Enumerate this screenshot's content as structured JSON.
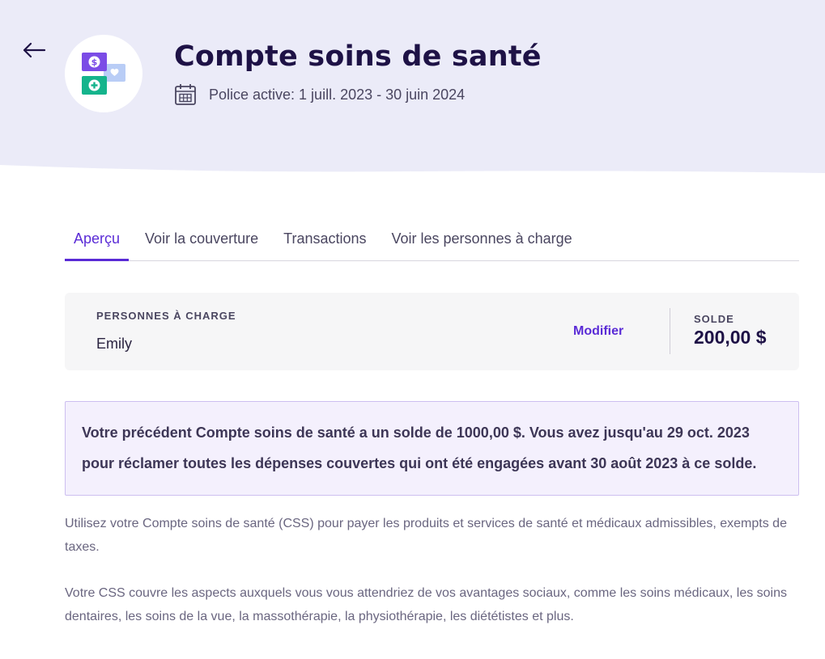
{
  "header": {
    "title": "Compte soins de santé",
    "policy_period": "Police active: 1 juill. 2023 - 30 juin 2024",
    "background_color": "#ebebf8"
  },
  "tabs": [
    {
      "label": "Aperçu",
      "active": true
    },
    {
      "label": "Voir la couverture",
      "active": false
    },
    {
      "label": "Transactions",
      "active": false
    },
    {
      "label": "Voir les personnes à charge",
      "active": false
    }
  ],
  "summary": {
    "dependents_label": "PERSONNES À CHARGE",
    "dependent_name": "Emily",
    "modify_label": "Modifier",
    "balance_label": "SOLDE",
    "balance_value": "200,00 $"
  },
  "notice": {
    "text": "Votre précédent Compte soins de santé a un solde de 1000,00 $. Vous avez jusqu'au 29 oct. 2023 pour réclamer toutes les dépenses couvertes qui ont été engagées avant 30 août 2023 à ce solde."
  },
  "description": {
    "paragraph_1": "Utilisez votre Compte soins de santé (CSS) pour payer les produits et services de santé et médicaux admissibles, exempts de taxes.",
    "paragraph_2": "Votre CSS couvre les aspects auxquels vous vous attendriez de vos avantages sociaux, comme les soins médicaux, les soins dentaires, les soins de la vue, la massothérapie, la physiothérapie, les diététistes et plus."
  },
  "colors": {
    "accent": "#5a2bd6",
    "title": "#1e1246",
    "notice_background": "#f4f0fd"
  },
  "icons": {
    "back": "arrow-left-icon",
    "app": "health-account-icon",
    "calendar": "calendar-icon"
  }
}
